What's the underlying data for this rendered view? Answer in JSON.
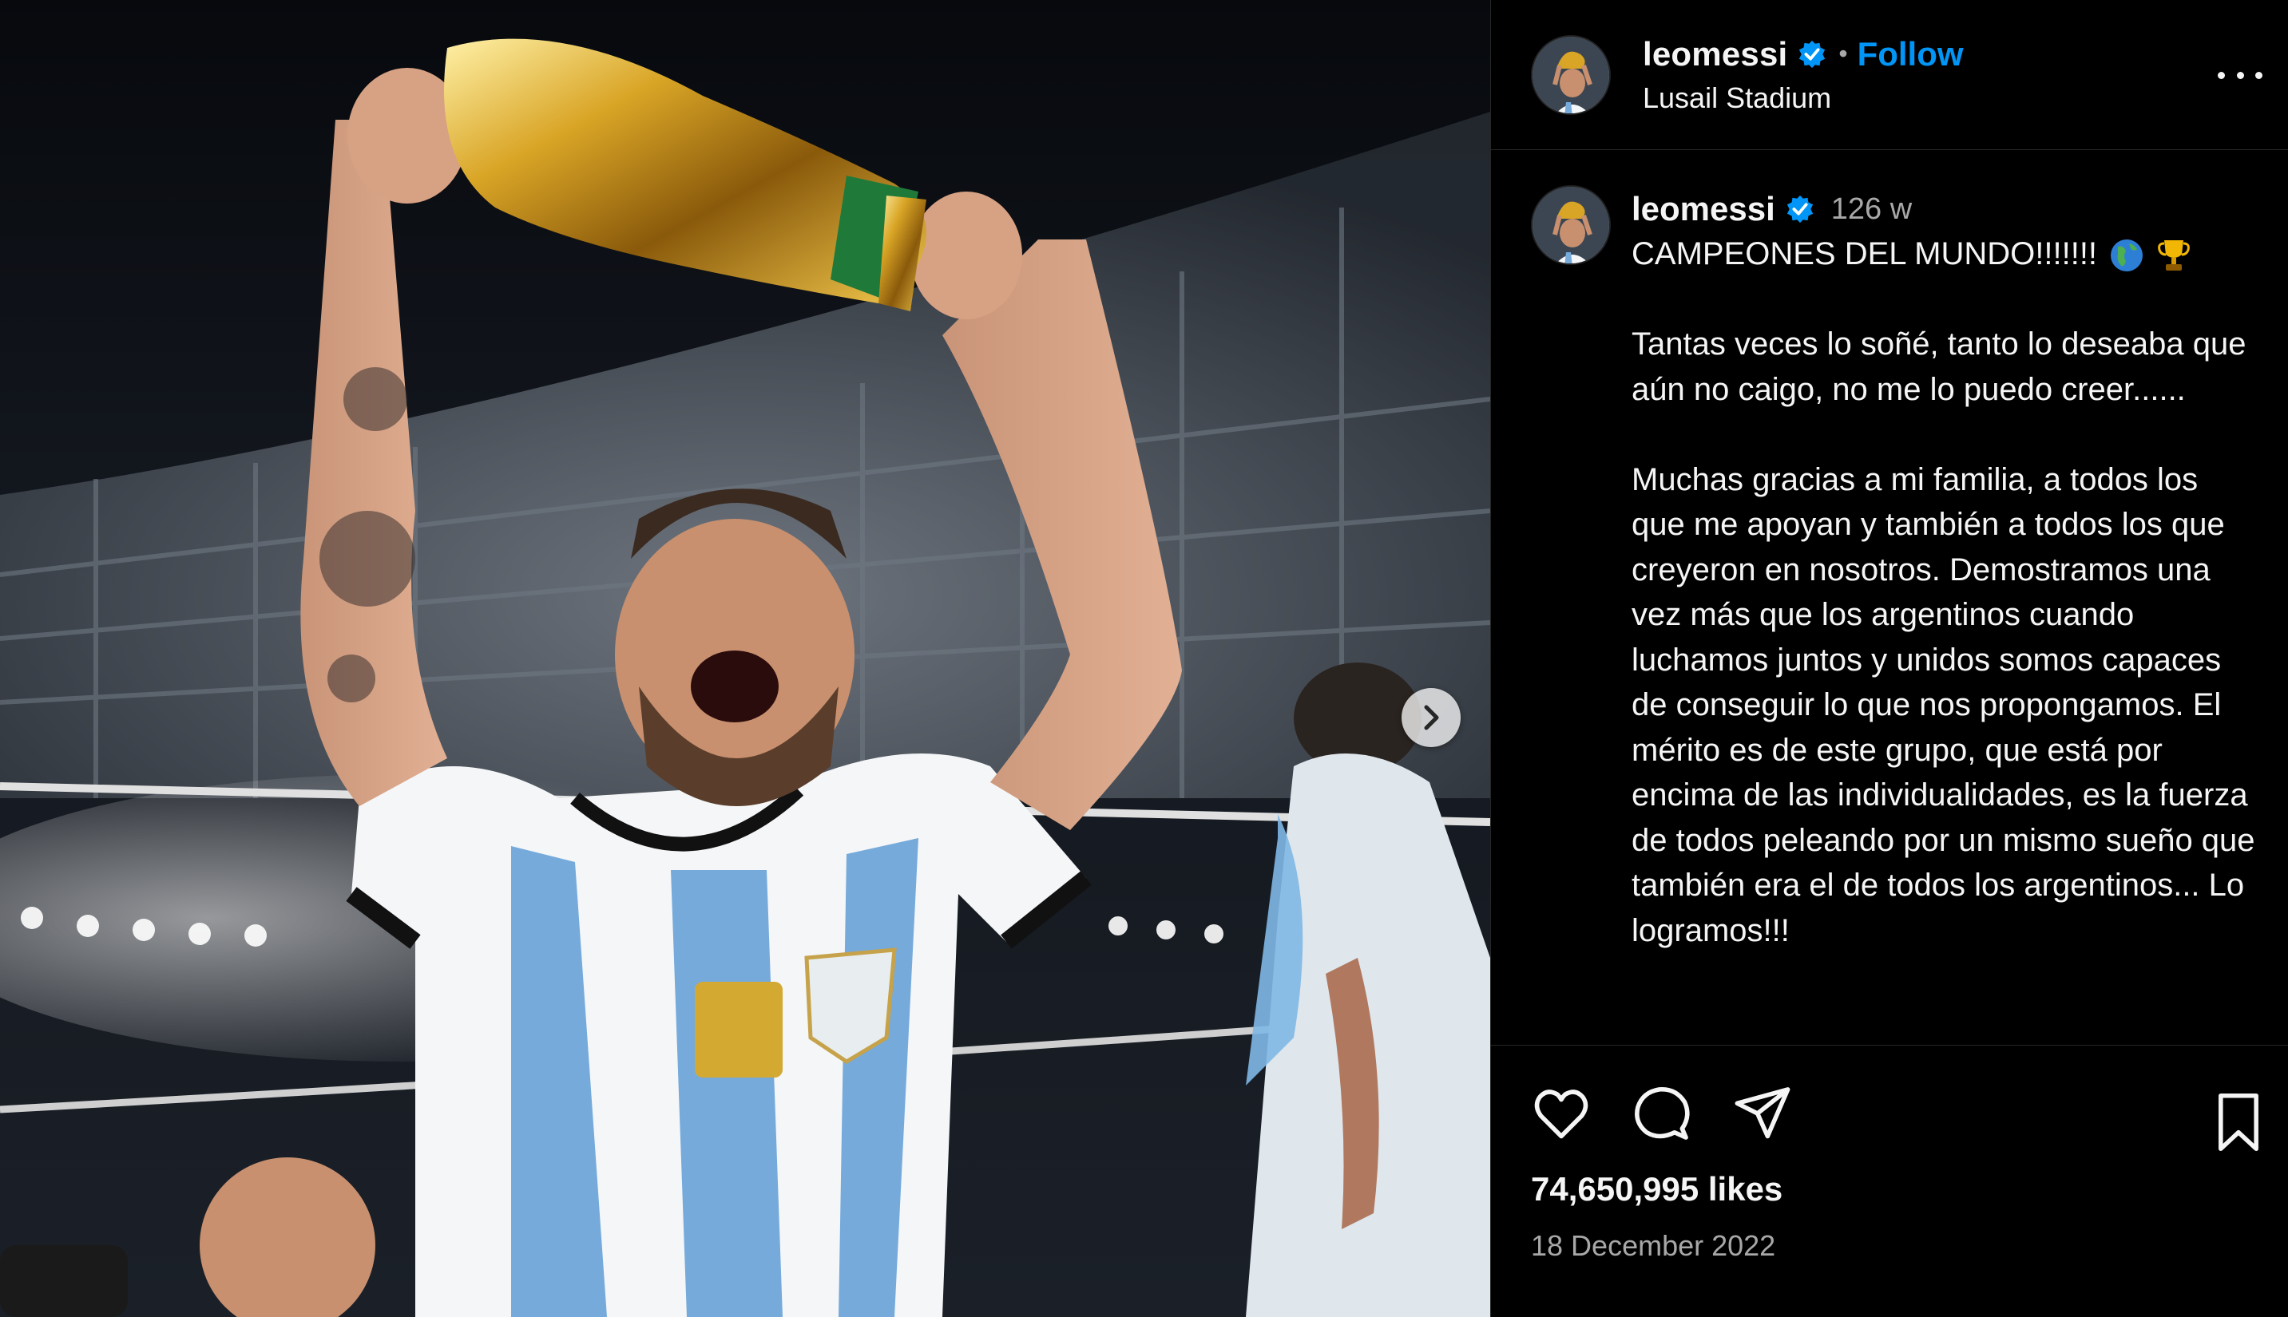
{
  "post": {
    "username": "leomessi",
    "verified_icon": "verified-badge-icon",
    "separator": "•",
    "follow_label": "Follow",
    "location": "Lusail Stadium",
    "more_icon": "more-options-icon",
    "next_icon": "chevron-right-icon"
  },
  "caption": {
    "username": "leomessi",
    "age": "126 w",
    "headline": "CAMPEONES DEL MUNDO!!!!!!!",
    "emojis": [
      "globe-americas-icon",
      "trophy-icon"
    ],
    "paragraph1": "Tantas veces lo soñé, tanto lo deseaba que aún no caigo, no me lo puedo creer......",
    "paragraph2": "Muchas gracias a mi familia, a todos los que me apoyan y también a todos los que creyeron en nosotros. Demostramos una vez más que los argentinos cuando luchamos juntos y unidos somos capaces de conseguir lo que nos propongamos. El mérito es de este grupo, que está por encima de las individualidades, es la fuerza de todos peleando por un mismo sueño que también era el de todos los argentinos... Lo logramos!!!"
  },
  "actions": {
    "icons": [
      "heart-icon",
      "comment-icon",
      "share-icon",
      "bookmark-icon"
    ],
    "likes": "74,650,995 likes",
    "date": "18 December 2022"
  },
  "colors": {
    "background": "#000000",
    "text": "#f5f5f5",
    "secondary": "#a8a8a8",
    "follow": "#0095f6",
    "verified": "#0095f6",
    "divider": "#262626"
  }
}
